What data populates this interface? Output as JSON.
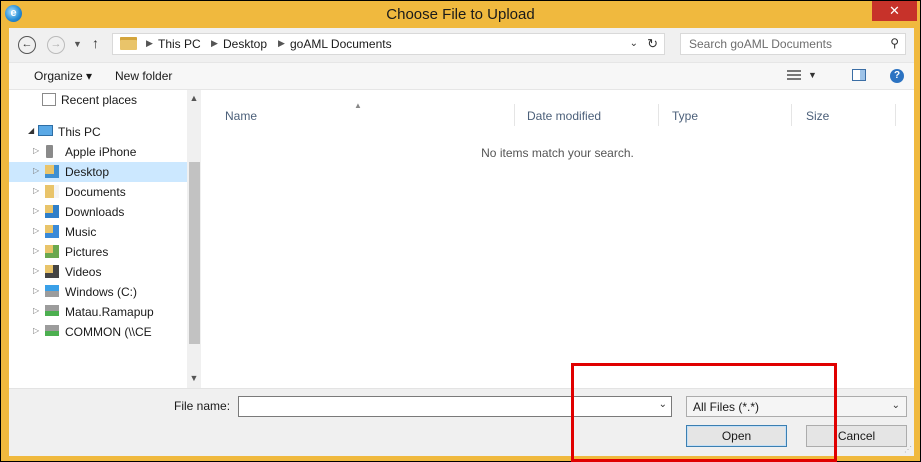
{
  "window": {
    "title": "Choose File to Upload",
    "app_icon": "internet-explorer-icon",
    "close_glyph": "✕"
  },
  "address": {
    "breadcrumbs": [
      "This PC",
      "Desktop",
      "goAML Documents"
    ],
    "search_placeholder": "Search goAML Documents"
  },
  "toolbar": {
    "organize_label": "Organize ▾",
    "new_folder_label": "New folder"
  },
  "nav_pane": {
    "items": [
      {
        "label": "Recent places",
        "icon": "recent-places-icon"
      },
      {
        "label": "This PC",
        "icon": "computer-icon"
      },
      {
        "label": "Apple iPhone",
        "icon": "phone-icon"
      },
      {
        "label": "Desktop",
        "icon": "desktop-folder-icon",
        "selected": true
      },
      {
        "label": "Documents",
        "icon": "documents-folder-icon"
      },
      {
        "label": "Downloads",
        "icon": "downloads-folder-icon"
      },
      {
        "label": "Music",
        "icon": "music-folder-icon"
      },
      {
        "label": "Pictures",
        "icon": "pictures-folder-icon"
      },
      {
        "label": "Videos",
        "icon": "videos-folder-icon"
      },
      {
        "label": "Windows (C:)",
        "icon": "drive-icon"
      },
      {
        "label": "Matau.Ramapup",
        "icon": "network-drive-icon"
      },
      {
        "label": "COMMON (\\\\CE",
        "icon": "network-drive-icon"
      }
    ]
  },
  "file_list": {
    "columns": [
      "Name",
      "Date modified",
      "Type",
      "Size"
    ],
    "empty_message": "No items match your search."
  },
  "bottom": {
    "file_name_label": "File name:",
    "file_name_value": "",
    "file_type_value": "All Files (*.*)",
    "open_label": "Open",
    "cancel_label": "Cancel"
  },
  "colors": {
    "title_bar": "#f0b93e",
    "close_button": "#c7322a",
    "selection": "#cce8ff",
    "highlight_box": "#e00000"
  }
}
